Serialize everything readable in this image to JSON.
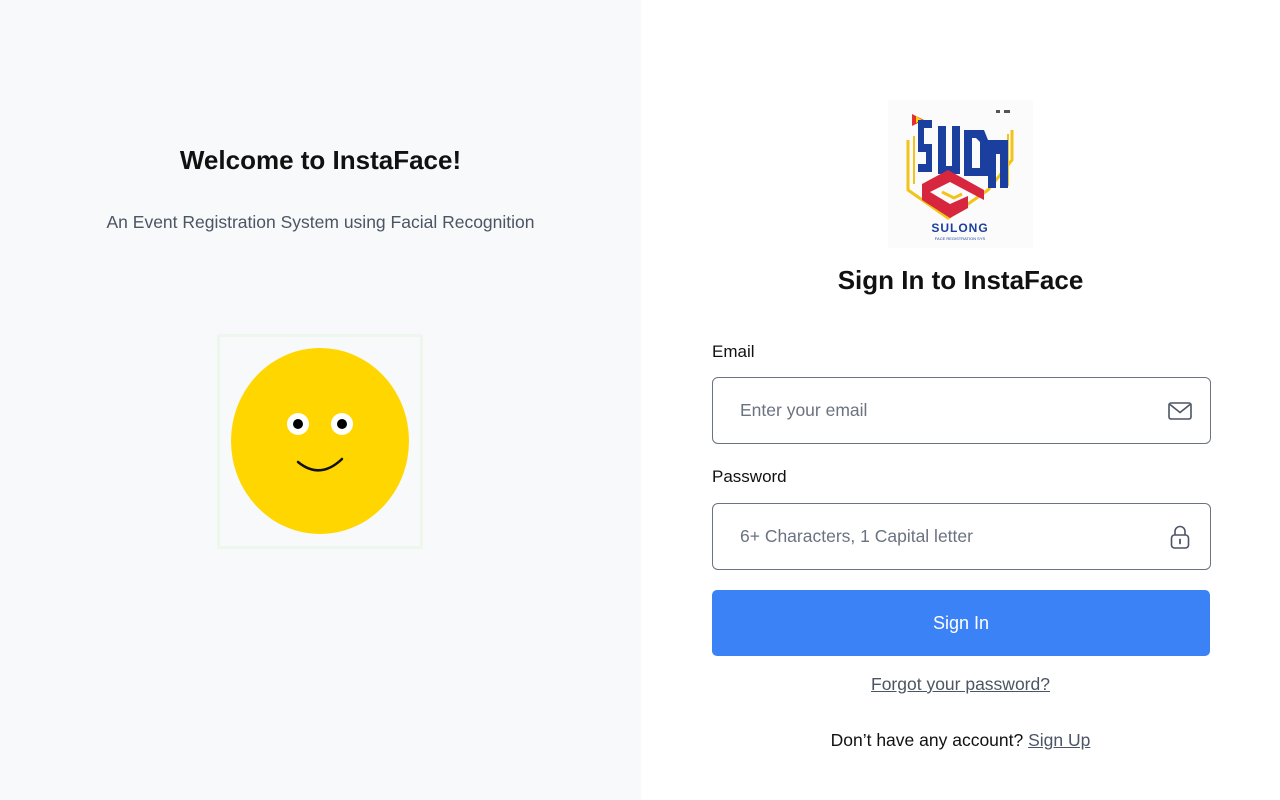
{
  "welcome": {
    "title": "Welcome to InstaFace!",
    "subtitle": "An Event Registration System using Facial Recognition"
  },
  "logo": {
    "text": "SULONG",
    "tagline": "FACE REGISTRATION SYS"
  },
  "signin": {
    "title": "Sign In to InstaFace",
    "email_label": "Email",
    "email_placeholder": "Enter your email",
    "email_icon": "mail-icon",
    "password_label": "Password",
    "password_placeholder": "6+ Characters, 1 Capital letter",
    "password_icon": "lock-icon",
    "button_label": "Sign In",
    "forgot_label": "Forgot your password?",
    "no_account_text": "Don’t have any account?",
    "signup_label": "Sign Up"
  },
  "colors": {
    "primary": "#3b82f6",
    "left_background": "#f8f9fa",
    "face_yellow": "#ffd600"
  }
}
